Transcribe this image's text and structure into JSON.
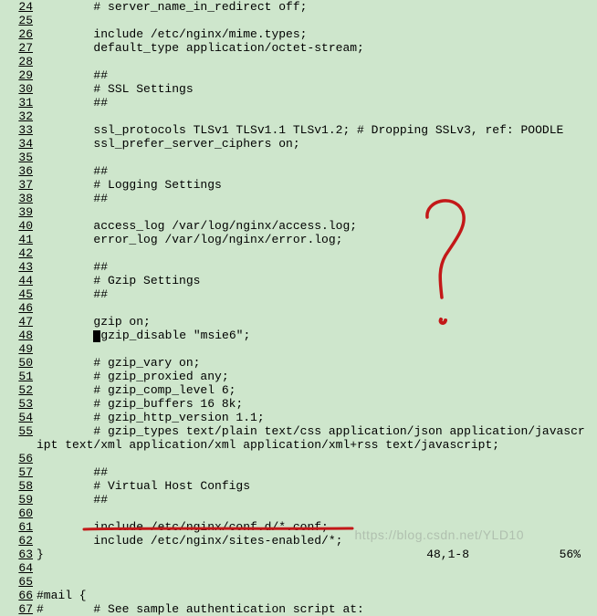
{
  "lines": [
    {
      "n": "24",
      "t": "        # server_name_in_redirect off;"
    },
    {
      "n": "25",
      "t": ""
    },
    {
      "n": "26",
      "t": "        include /etc/nginx/mime.types;"
    },
    {
      "n": "27",
      "t": "        default_type application/octet-stream;"
    },
    {
      "n": "28",
      "t": ""
    },
    {
      "n": "29",
      "t": "        ##"
    },
    {
      "n": "30",
      "t": "        # SSL Settings"
    },
    {
      "n": "31",
      "t": "        ##"
    },
    {
      "n": "32",
      "t": ""
    },
    {
      "n": "33",
      "t": "        ssl_protocols TLSv1 TLSv1.1 TLSv1.2; # Dropping SSLv3, ref: POODLE"
    },
    {
      "n": "34",
      "t": "        ssl_prefer_server_ciphers on;"
    },
    {
      "n": "35",
      "t": ""
    },
    {
      "n": "36",
      "t": "        ##"
    },
    {
      "n": "37",
      "t": "        # Logging Settings"
    },
    {
      "n": "38",
      "t": "        ##"
    },
    {
      "n": "39",
      "t": ""
    },
    {
      "n": "40",
      "t": "        access_log /var/log/nginx/access.log;"
    },
    {
      "n": "41",
      "t": "        error_log /var/log/nginx/error.log;"
    },
    {
      "n": "42",
      "t": ""
    },
    {
      "n": "43",
      "t": "        ##"
    },
    {
      "n": "44",
      "t": "        # Gzip Settings"
    },
    {
      "n": "45",
      "t": "        ##"
    },
    {
      "n": "46",
      "t": ""
    },
    {
      "n": "47",
      "t": "        gzip on;"
    },
    {
      "n": "48",
      "t": "        ",
      "cursor": true,
      "after": "gzip_disable \"msie6\";"
    },
    {
      "n": "49",
      "t": ""
    },
    {
      "n": "50",
      "t": "        # gzip_vary on;"
    },
    {
      "n": "51",
      "t": "        # gzip_proxied any;"
    },
    {
      "n": "52",
      "t": "        # gzip_comp_level 6;"
    },
    {
      "n": "53",
      "t": "        # gzip_buffers 16 8k;"
    },
    {
      "n": "54",
      "t": "        # gzip_http_version 1.1;"
    },
    {
      "n": "55",
      "t": "        # gzip_types text/plain text/css application/json application/javascr"
    },
    {
      "n": "",
      "t": "ipt text/xml application/xml application/xml+rss text/javascript;",
      "wrap": true
    },
    {
      "n": "56",
      "t": ""
    },
    {
      "n": "57",
      "t": "        ##"
    },
    {
      "n": "58",
      "t": "        # Virtual Host Configs"
    },
    {
      "n": "59",
      "t": "        ##"
    },
    {
      "n": "60",
      "t": ""
    },
    {
      "n": "61",
      "t": "        include /etc/nginx/conf.d/*.conf;"
    },
    {
      "n": "62",
      "t": "        include /etc/nginx/sites-enabled/*;"
    },
    {
      "n": "63",
      "t": "}"
    },
    {
      "n": "64",
      "t": ""
    },
    {
      "n": "65",
      "t": ""
    },
    {
      "n": "66",
      "t": "#mail {"
    },
    {
      "n": "67",
      "t": "#       # See sample authentication script at:"
    }
  ],
  "status": {
    "pos": "48,1-8",
    "pct": "56%"
  },
  "watermark": "https://blog.csdn.net/YLD10"
}
